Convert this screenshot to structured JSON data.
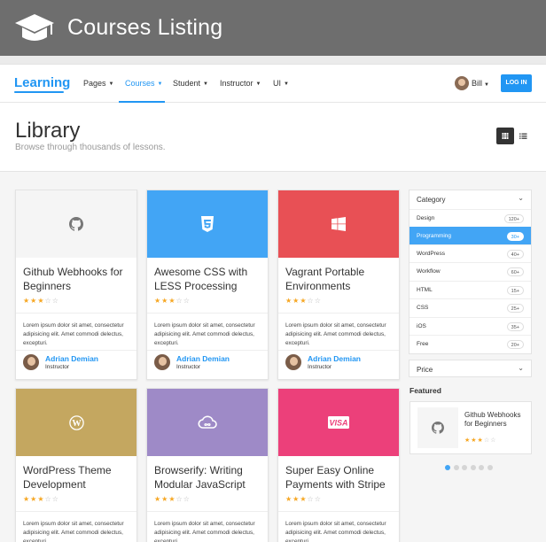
{
  "banner": {
    "title": "Courses Listing",
    "icon": "graduation-cap-icon"
  },
  "navbar": {
    "logo": "Learning",
    "items": [
      {
        "label": "Pages"
      },
      {
        "label": "Courses"
      },
      {
        "label": "Student"
      },
      {
        "label": "Instructor"
      },
      {
        "label": "UI"
      }
    ],
    "active_item": "Courses",
    "user": "Bill",
    "login": "LOG IN"
  },
  "header": {
    "title": "Library",
    "subtitle": "Browse through thousands of lessons."
  },
  "courses": [
    {
      "title": "Github Webhooks for Beginners",
      "icon": "github-icon",
      "color": "#f5f5f5",
      "rating": 3,
      "description": "Lorem ipsum dolor sit amet, consectetur adipisicing elit. Amet commodi delectus, excepturi.",
      "author": "Adrian Demian",
      "role": "Instructor"
    },
    {
      "title": "Awesome CSS with LESS Processing",
      "icon": "css3-icon",
      "color": "#42a5f5",
      "rating": 3,
      "description": "Lorem ipsum dolor sit amet, consectetur adipisicing elit. Amet commodi delectus, excepturi.",
      "author": "Adrian Demian",
      "role": "Instructor"
    },
    {
      "title": "Vagrant Portable Environments",
      "icon": "windows-icon",
      "color": "#e85055",
      "rating": 3,
      "description": "Lorem ipsum dolor sit amet, consectetur adipisicing elit. Amet commodi delectus, excepturi.",
      "author": "Adrian Demian",
      "role": "Instructor"
    },
    {
      "title": "WordPress Theme Development",
      "icon": "wordpress-icon",
      "color": "#c4a760",
      "rating": 3,
      "description": "Lorem ipsum dolor sit amet, consectetur adipisicing elit. Amet commodi delectus, excepturi."
    },
    {
      "title": "Browserify: Writing Modular JavaScript",
      "icon": "cloud-icon",
      "color": "#9e8ac7",
      "rating": 3,
      "description": "Lorem ipsum dolor sit amet, consectetur adipisicing elit. Amet commodi delectus, excepturi."
    },
    {
      "title": "Super Easy Online Payments with Stripe",
      "icon": "visa-icon",
      "color": "#ec407a",
      "rating": 3,
      "description": "Lorem ipsum dolor sit amet, consectetur adipisicing elit. Amet commodi delectus, excepturi."
    }
  ],
  "sidebar": {
    "category_title": "Category",
    "categories": [
      {
        "label": "Design",
        "count": "120+"
      },
      {
        "label": "Programming",
        "count": "30+"
      },
      {
        "label": "WordPress",
        "count": "40+"
      },
      {
        "label": "Workflow",
        "count": "60+"
      },
      {
        "label": "HTML",
        "count": "15+"
      },
      {
        "label": "CSS",
        "count": "25+"
      },
      {
        "label": "iOS",
        "count": "35+"
      },
      {
        "label": "Free",
        "count": "20+"
      }
    ],
    "active_category": "Programming",
    "price_title": "Price",
    "featured_title": "Featured",
    "featured": {
      "title": "Github Webhooks for Beginners",
      "icon": "github-icon",
      "rating": 3
    },
    "carousel": {
      "count": 6,
      "active": 0
    }
  },
  "colors": {
    "accent": "#2196f3",
    "star": "#f6a723",
    "banner": "#6e6e6e"
  }
}
